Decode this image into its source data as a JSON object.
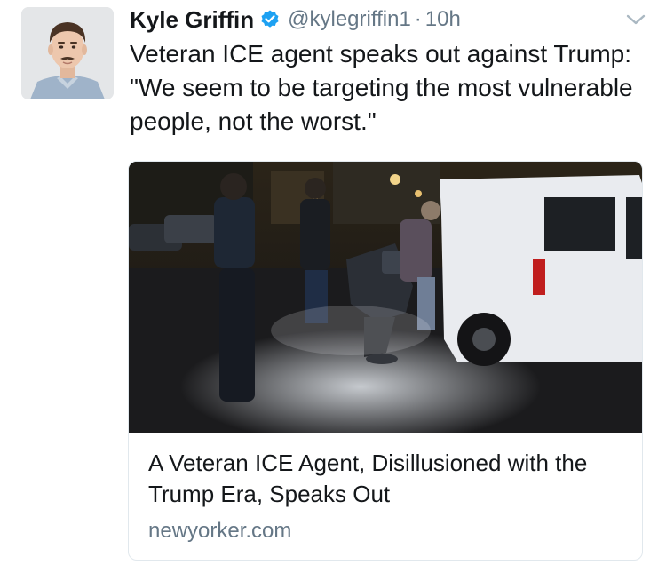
{
  "tweet": {
    "author_name": "Kyle Griffin",
    "handle": "@kylegriffin1",
    "separator": "·",
    "timestamp": "10h",
    "text": "Veteran ICE agent speaks out against Trump: \"We seem to be targeting the most vulnerable people, not the worst.\"",
    "verified": true
  },
  "card": {
    "title": "A Veteran ICE Agent, Disillusioned with the Trump Era, Speaks Out",
    "domain": "newyorker.com"
  },
  "icons": {
    "verified": "verified-badge-icon",
    "caret": "chevron-down-icon"
  },
  "colors": {
    "text": "#14171a",
    "secondary": "#657786",
    "verified_blue": "#1da1f2",
    "border": "#e1e8ed"
  }
}
